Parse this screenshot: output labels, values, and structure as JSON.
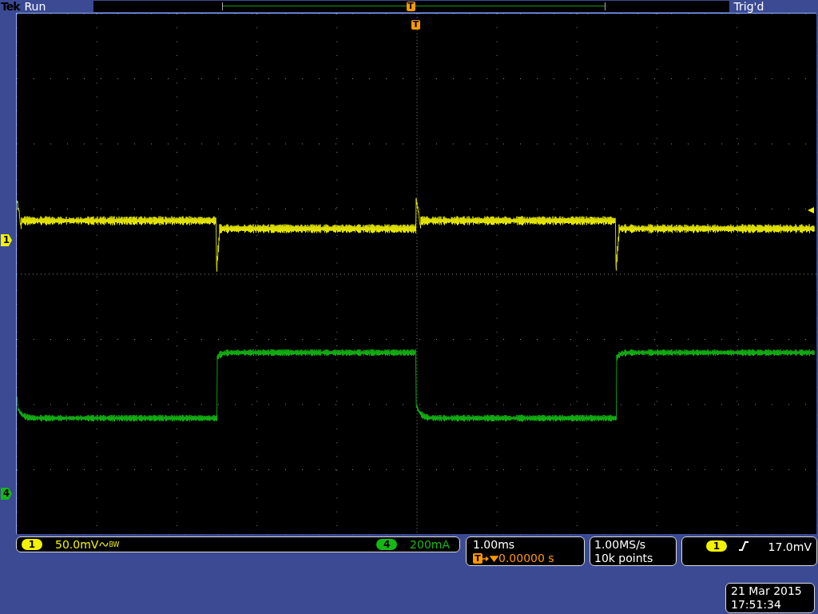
{
  "header": {
    "brand": "Tek",
    "status": "Run",
    "trigger_status": "Trig'd",
    "trigger_marker": "T"
  },
  "graticule": {
    "trigger_marker": "T"
  },
  "channel_markers": [
    {
      "label": "1",
      "color": "#f2f200"
    },
    {
      "label": "4",
      "color": "#14b814"
    }
  ],
  "channels": [
    {
      "number": "1",
      "color": "#f2f200",
      "scale": "50.0mV",
      "bandwidth": "BW"
    },
    {
      "number": "4",
      "color": "#14b814",
      "scale": "200mA"
    }
  ],
  "timebase": {
    "scale": "1.00ms",
    "trigger_marker": "T",
    "delay": "0.00000 s"
  },
  "acquisition": {
    "sample_rate": "1.00MS/s",
    "record_length": "10k points"
  },
  "trigger": {
    "source": "1",
    "color": "#f2f200",
    "level": "17.0mV"
  },
  "timestamp": {
    "date": "21 Mar 2015",
    "time": "17:51:34"
  }
}
